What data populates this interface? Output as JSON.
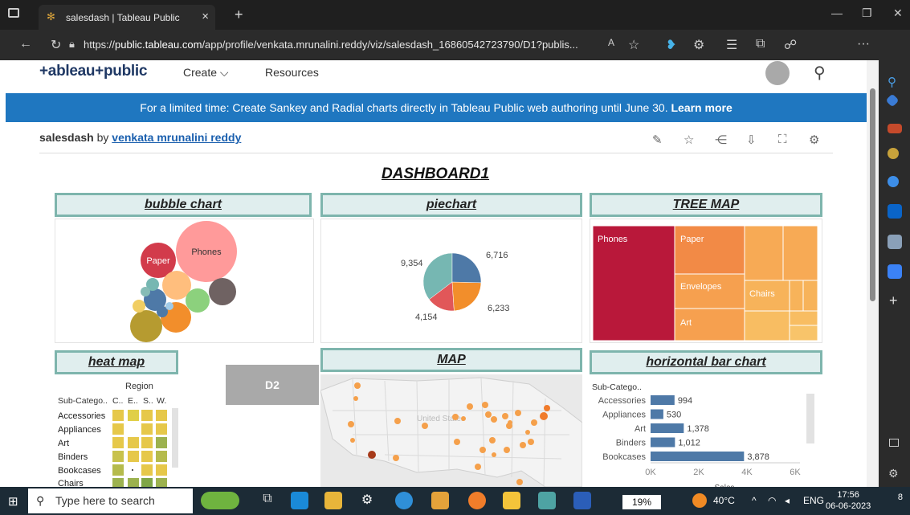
{
  "browser": {
    "tab_title": "salesdash | Tableau Public",
    "tab_close": "×",
    "new_tab": "+",
    "url_prefix": "https://",
    "url_host": "public.tableau.com",
    "url_path": "/app/profile/venkata.mrunalini.reddy/viz/salesdash_16860542723790/D1?publis...",
    "more": "···"
  },
  "tableau": {
    "logo": "+ableau+public",
    "nav": [
      "Create ⌵",
      "Resources"
    ],
    "banner_text": "For a limited time: Create Sankey and Radial charts directly in Tableau Public web authoring until June 30.",
    "banner_link": "Learn more",
    "viz_title": "salesdash",
    "viz_by": "by",
    "viz_author": "venkata mrunalini reddy"
  },
  "dashboard": {
    "title": "DASHBOARD1",
    "sheets": {
      "bubble": "bubble chart",
      "pie": "piechart",
      "tree": "TREE MAP",
      "heat": "heat map",
      "map": "MAP",
      "hbar": "horizontal bar chart"
    },
    "d2_button": "D2"
  },
  "bubble_labels": [
    "Phones",
    "Paper"
  ],
  "pie_labels": [
    "6,716",
    "6,233",
    "4,154",
    "9,354"
  ],
  "tree_labels": [
    "Phones",
    "Paper",
    "Envelopes",
    "Chairs",
    "Art"
  ],
  "heatmap": {
    "region_label": "Region",
    "col_header": "Sub-Catego..",
    "cols": [
      "C..",
      "E..",
      "S..",
      "W."
    ],
    "rows": [
      "Accessories",
      "Appliances",
      "Art",
      "Binders",
      "Bookcases",
      "Chairs"
    ]
  },
  "map_label": "United States",
  "chart_data": [
    {
      "type": "pie",
      "values": [
        6716,
        6233,
        4154,
        9354
      ],
      "colors": [
        "#4e79a7",
        "#f28e2b",
        "#e15759",
        "#76b7b2"
      ]
    },
    {
      "type": "bar",
      "orientation": "horizontal",
      "ylabel": "Sub-Catego..",
      "xlabel": "Sales",
      "categories": [
        "Accessories",
        "Appliances",
        "Art",
        "Binders",
        "Bookcases"
      ],
      "values": [
        994,
        530,
        1378,
        1012,
        3878
      ],
      "value_labels": [
        "994",
        "530",
        "1,378",
        "1,012",
        "3,878"
      ],
      "xticks": [
        "0K",
        "2K",
        "4K",
        "6K"
      ],
      "xlim": [
        0,
        7000
      ],
      "color": "#4e79a7"
    }
  ],
  "taskbar": {
    "search_placeholder": "Type here to search",
    "battery": "19%",
    "temp": "40°C",
    "lang": "ENG",
    "time": "17:56",
    "date": "06-06-2023",
    "notif": "8"
  }
}
